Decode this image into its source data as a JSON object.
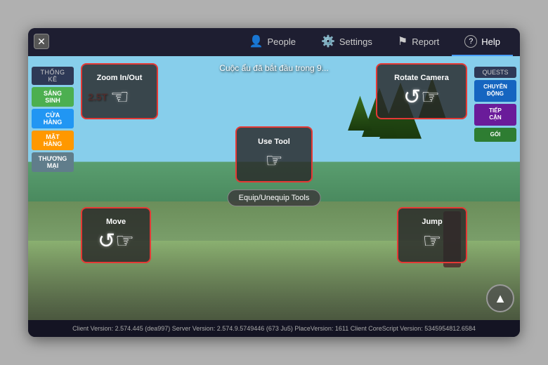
{
  "window": {
    "close_label": "✕"
  },
  "nav": {
    "tabs": [
      {
        "id": "people",
        "label": "People",
        "icon": "👤",
        "active": false
      },
      {
        "id": "settings",
        "label": "Settings",
        "icon": "⚙️",
        "active": false
      },
      {
        "id": "report",
        "label": "Report",
        "icon": "⚑",
        "active": false
      },
      {
        "id": "help",
        "label": "Help",
        "icon": "?",
        "active": true
      }
    ]
  },
  "announcement": "Cuộc ẩu đã bắt đầu trong 9...",
  "price": "2.5T",
  "left_sidebar": {
    "header": "THỐNG KÊ",
    "buttons": [
      {
        "label": "SÁNG\nSINH",
        "color": "green"
      },
      {
        "label": "CỬA\nHÀNG",
        "color": "blue"
      },
      {
        "label": "MẶT HÀNG",
        "color": "orange"
      },
      {
        "label": "THƯƠNG\nMẠI",
        "color": "gray"
      }
    ]
  },
  "right_sidebar": {
    "header": "QUESTS",
    "buttons": [
      {
        "label": "CHUYÊN\nĐỘNG",
        "color": "blue"
      },
      {
        "label": "TIẾP\nCẬN",
        "color": "purple"
      },
      {
        "label": "GÓI",
        "color": "green"
      }
    ]
  },
  "controls": {
    "zoom": {
      "label": "Zoom In/Out",
      "icon": "☞"
    },
    "rotate": {
      "label": "Rotate Camera",
      "icon": "☞"
    },
    "use_tool": {
      "label": "Use Tool",
      "icon": "☞"
    },
    "equip": {
      "label": "Equip/Unequip Tools"
    },
    "move": {
      "label": "Move",
      "icon": "☞"
    },
    "jump": {
      "label": "Jump",
      "icon": "☞"
    }
  },
  "status_bar": {
    "text": "Client Version: 2.574.445 (dea997)    Server Version: 2.574.9.5749446 (673 Ju5)    PlaceVersion: 1611    Client CoreScript Version: 5345954812.6584"
  }
}
